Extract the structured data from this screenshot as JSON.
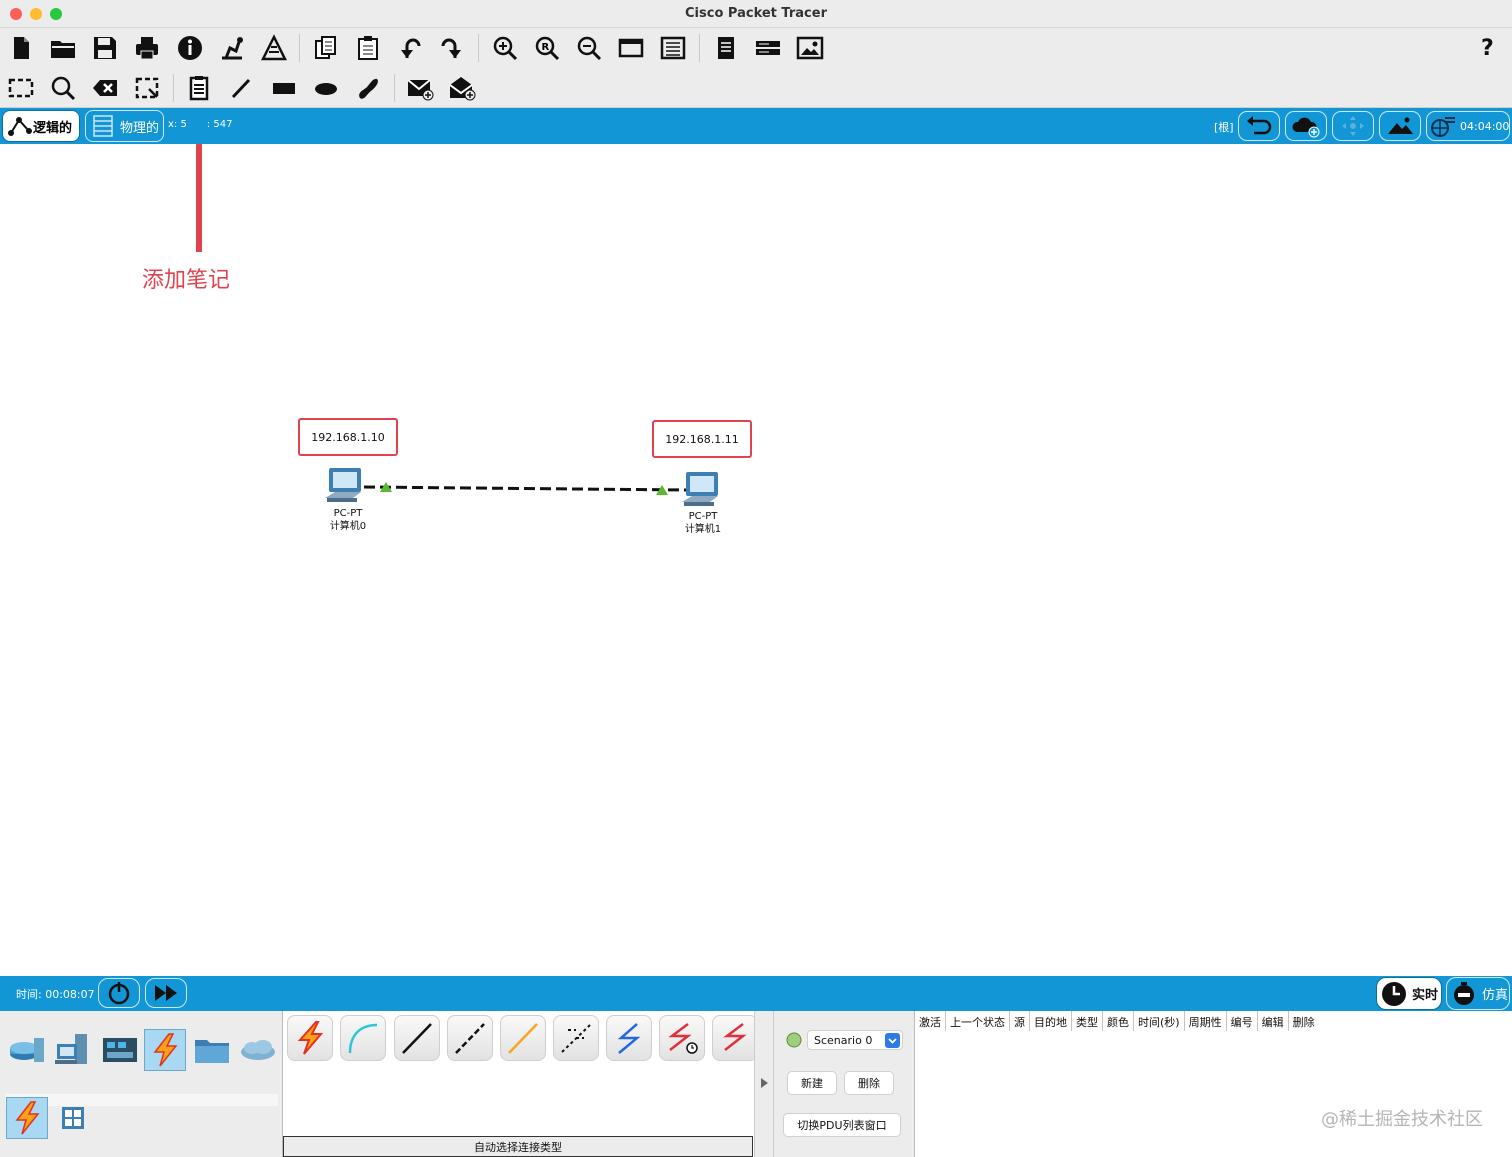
{
  "window": {
    "title": "Cisco Packet Tracer",
    "traffic_lights": [
      "#fe5f57",
      "#febc2e",
      "#28c840"
    ]
  },
  "toolbar_main": {
    "icons": [
      "new-file-icon",
      "open-folder-icon",
      "save-icon",
      "print-icon",
      "info-icon",
      "activity-wizard-icon",
      "network-info-icon",
      "copy-icon",
      "paste-icon",
      "undo-icon",
      "redo-icon",
      "zoom-in-icon",
      "zoom-reset-icon",
      "zoom-out-icon",
      "drawing-palette-icon",
      "custom-device-icon",
      "document-icon",
      "server-rack-icon",
      "image-icon"
    ],
    "help_label": "?"
  },
  "toolbar_tools": {
    "icons": [
      "select-icon",
      "inspect-icon",
      "delete-icon",
      "resize-icon",
      "add-note-icon",
      "line-icon",
      "rectangle-icon",
      "ellipse-icon",
      "freeform-icon",
      "add-simple-pdu-icon",
      "add-complex-pdu-icon"
    ]
  },
  "workspace_bar": {
    "logical_tab": "逻辑的",
    "physical_tab": "物理的",
    "coords": "x: 5",
    "coords_y": ": 547",
    "root_label": "[根]",
    "clock": "04:04:00"
  },
  "canvas": {
    "annotation": "添加笔记",
    "annotation_color": "#e0434e",
    "devices": [
      {
        "ip": "192.168.1.10",
        "model": "PC-PT",
        "name": "计算机0"
      },
      {
        "ip": "192.168.1.11",
        "model": "PC-PT",
        "name": "计算机1"
      }
    ],
    "link_color": "#111111",
    "port_status_color": "#5bb832"
  },
  "bottom_bar": {
    "time_label": "时间: 00:08:07",
    "realtime_label": "实时",
    "simulation_label": "仿真"
  },
  "device_panel": {
    "categories": [
      "network-devices-icon",
      "end-devices-icon",
      "components-icon",
      "connections-icon",
      "miscellaneous-icon",
      "multiuser-icon"
    ],
    "subtypes": [
      "connections-icon",
      "grid-icon"
    ]
  },
  "connections": {
    "cables": [
      "auto-connect",
      "console",
      "copper-straight",
      "copper-cross",
      "fiber",
      "phone",
      "coaxial",
      "serial-dce",
      "serial-dte"
    ],
    "caption": "自动选择连接类型"
  },
  "scenario": {
    "selected": "Scenario 0",
    "new_label": "新建",
    "delete_label": "删除",
    "toggle_label": "切换PDU列表窗口"
  },
  "pdu_table": {
    "columns": [
      "激活",
      "上一个状态",
      "源",
      "目的地",
      "类型",
      "颜色",
      "时间(秒)",
      "周期性",
      "编号",
      "编辑",
      "删除"
    ]
  },
  "watermark": "@稀土掘金技术社区"
}
